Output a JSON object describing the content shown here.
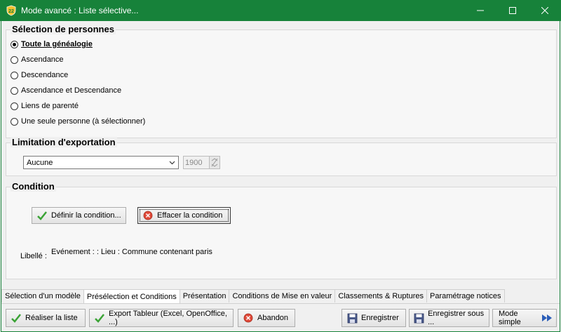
{
  "window": {
    "title": "Mode avancé : Liste sélective...",
    "app_icon": "tree-shield-icon",
    "accent": "#17823a"
  },
  "selection": {
    "title": "Sélection de personnes",
    "options": [
      {
        "label": "Toute la généalogie",
        "selected": true
      },
      {
        "label": "Ascendance",
        "selected": false
      },
      {
        "label": "Descendance",
        "selected": false
      },
      {
        "label": "Ascendance et Descendance",
        "selected": false
      },
      {
        "label": "Liens de parenté",
        "selected": false
      },
      {
        "label": "Une seule personne (à sélectionner)",
        "selected": false
      }
    ]
  },
  "limitation": {
    "title": "Limitation d'exportation",
    "select_value": "Aucune",
    "year_value": "1900"
  },
  "condition": {
    "title": "Condition",
    "define_label": "Définir la condition...",
    "clear_label": "Effacer la condition",
    "libelle_label": "Libellé :",
    "libelle_value": "Evénement :  :  Lieu : Commune contenant paris"
  },
  "tabs": [
    {
      "label": "Sélection d'un modèle",
      "active": false
    },
    {
      "label": "Présélection et Conditions",
      "active": true
    },
    {
      "label": "Présentation",
      "active": false
    },
    {
      "label": "Conditions de Mise en valeur",
      "active": false
    },
    {
      "label": "Classements & Ruptures",
      "active": false
    },
    {
      "label": "Paramétrage notices",
      "active": false
    }
  ],
  "footer": {
    "run_label": "Réaliser la liste",
    "export_label": "Export Tableur (Excel, OpenOffice, ...)",
    "abort_label": "Abandon",
    "save_label": "Enregistrer",
    "save_as_label": "Enregistrer sous ...",
    "simple_mode_label": "Mode simple"
  }
}
